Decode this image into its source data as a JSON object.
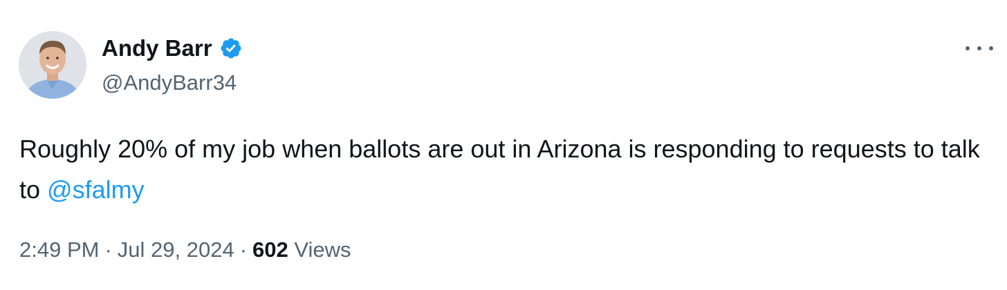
{
  "author": {
    "display_name": "Andy Barr",
    "handle": "@AndyBarr34",
    "verified": true,
    "verified_color": "#1d9bf0"
  },
  "tweet": {
    "text_before_mention": "Roughly 20% of my job when ballots are out in Arizona is responding to requests to talk to ",
    "mention": "@sfalmy"
  },
  "meta": {
    "time": "2:49 PM",
    "separator": "·",
    "date": "Jul 29, 2024",
    "views_count": "602",
    "views_label": "Views"
  },
  "icons": {
    "verified": "verified-badge-icon",
    "more": "more-options-icon"
  },
  "colors": {
    "text_primary": "#0f1419",
    "text_secondary": "#536471",
    "link": "#1d9bf0"
  }
}
